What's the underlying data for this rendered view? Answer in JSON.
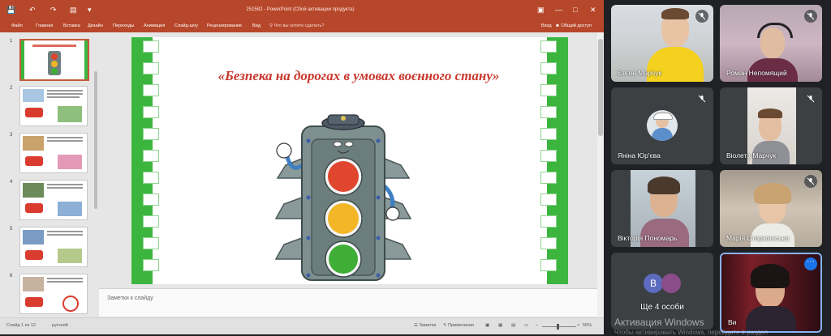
{
  "ppt": {
    "window_title": "251582 - PowerPoint (Сбой активации продукта)",
    "ribbon_tabs": [
      "Файл",
      "Главная",
      "Вставка",
      "Дизайн",
      "Переходы",
      "Анимация",
      "Слайд-шоу",
      "Рецензирование",
      "Вид"
    ],
    "tell_me": "Что вы хотите сделать?",
    "signin": "Вход",
    "share": "Общий доступ",
    "slide_numbers": [
      "1",
      "2",
      "3",
      "4",
      "5",
      "6"
    ],
    "slide_title": "«Безпека на дорогах в умовах воєнного стану»",
    "notes_placeholder": "Заметки к слайду",
    "status": {
      "slide_counter": "Слайд 1 из 12",
      "language": "русский",
      "notes_btn": "Заметки",
      "comments_btn": "Примечания",
      "zoom": "55%"
    }
  },
  "meet": {
    "participants": [
      {
        "name": "Євген Марчук"
      },
      {
        "name": "Роман Непомящий"
      },
      {
        "name": "Яніна Юр'єва"
      },
      {
        "name": "Віолета Марчук"
      },
      {
        "name": "Вікторія Пономарь"
      },
      {
        "name": "Марія Сторжинська"
      },
      {
        "name": "Ще 4 особи",
        "avatar_letter": "В"
      },
      {
        "name": "Ви"
      }
    ],
    "activation_watermark": "Активация Windows",
    "activation_sub": "Чтобы активировать Windows, перейдите в раздел"
  },
  "colors": {
    "ppt_accent": "#b7472a",
    "slide_green": "#3cb53f",
    "meet_bg": "#202124",
    "active_speaker": "#8ab4f8"
  }
}
